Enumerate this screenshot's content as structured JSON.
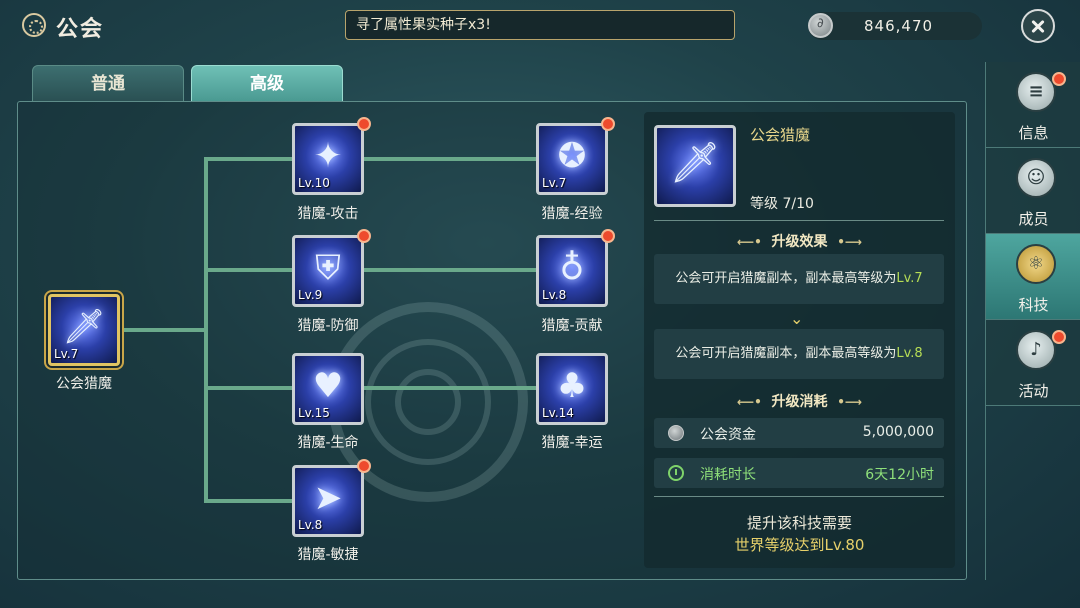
{
  "header": {
    "title": "公会",
    "ticker_text": "寻了属性果实种子x3!",
    "currency_value": "846,470"
  },
  "tabs": [
    {
      "label": "普通",
      "active": false
    },
    {
      "label": "高级",
      "active": true
    }
  ],
  "tree": {
    "root": {
      "name": "公会猎魔",
      "level": "Lv.7",
      "icon": "sword-icon"
    },
    "nodes": [
      {
        "name": "猎魔-攻击",
        "level": "Lv.10",
        "icon": "claw-icon",
        "alert": true
      },
      {
        "name": "猎魔-防御",
        "level": "Lv.9",
        "icon": "shield-icon",
        "alert": true
      },
      {
        "name": "猎魔-生命",
        "level": "Lv.15",
        "icon": "heart-icon",
        "alert": false
      },
      {
        "name": "猎魔-敏捷",
        "level": "Lv.8",
        "icon": "boot-icon",
        "alert": true
      },
      {
        "name": "猎魔-经验",
        "level": "Lv.7",
        "icon": "medal-icon",
        "alert": true
      },
      {
        "name": "猎魔-贡献",
        "level": "Lv.8",
        "icon": "planet-icon",
        "alert": true
      },
      {
        "name": "猎魔-幸运",
        "level": "Lv.14",
        "icon": "clover-icon",
        "alert": false
      }
    ]
  },
  "detail": {
    "name": "公会猎魔",
    "level_text": "等级 7/10",
    "effect_title": "升级效果",
    "effect_current_prefix": "公会可开启猎魔副本，副本最高等级为",
    "effect_current_level": "Lv.7",
    "effect_next_prefix": "公会可开启猎魔副本，副本最高等级为",
    "effect_next_level": "Lv.8",
    "cost_title": "升级消耗",
    "fund_label": "公会资金",
    "fund_value": "5,000,000",
    "time_label": "消耗时长",
    "time_value": "6天12小时",
    "requirement_line1": "提升该科技需要",
    "requirement_line2": "世界等级达到Lv.80"
  },
  "sidebar": [
    {
      "label": "信息",
      "icon": "document-icon",
      "alert": true,
      "active": false
    },
    {
      "label": "成员",
      "icon": "members-icon",
      "alert": false,
      "active": false
    },
    {
      "label": "科技",
      "icon": "atom-icon",
      "alert": false,
      "active": true
    },
    {
      "label": "活动",
      "icon": "bell-icon",
      "alert": true,
      "active": false
    }
  ],
  "colors": {
    "accent": "#6aa98b",
    "alert": "#ee4a2d",
    "level_highlight": "#b6dd55",
    "gold": "#e6d06a"
  }
}
